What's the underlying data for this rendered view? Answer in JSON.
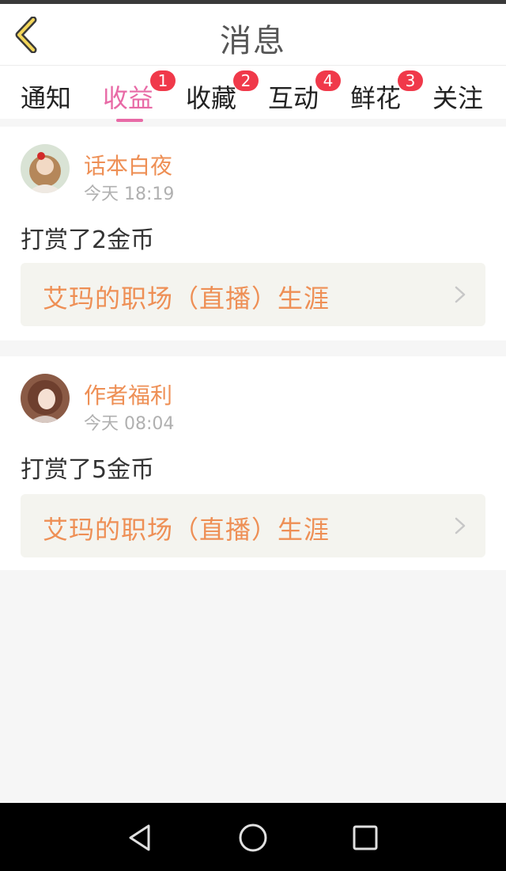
{
  "header": {
    "title": "消息",
    "back_icon": "chevron-left-icon"
  },
  "tabs": [
    {
      "label": "通知",
      "badge": ""
    },
    {
      "label": "收益",
      "badge": "1",
      "active": true
    },
    {
      "label": "收藏",
      "badge": "2"
    },
    {
      "label": "互动",
      "badge": "4"
    },
    {
      "label": "鲜花",
      "badge": "3"
    },
    {
      "label": "关注",
      "badge": ""
    }
  ],
  "messages": [
    {
      "user": "话本白夜",
      "time": "今天 18:19",
      "text": "打赏了2金币",
      "link_title": "艾玛的职场（直播）生涯"
    },
    {
      "user": "作者福利",
      "time": "今天 08:04",
      "text": "打赏了5金币",
      "link_title": "艾玛的职场（直播）生涯"
    }
  ],
  "colors": {
    "accent_pink": "#e86aa6",
    "name_orange": "#ee8f55",
    "badge_red": "#f0394a"
  },
  "navbar": {
    "icons": [
      "back-triangle-icon",
      "home-circle-icon",
      "recents-square-icon"
    ]
  }
}
